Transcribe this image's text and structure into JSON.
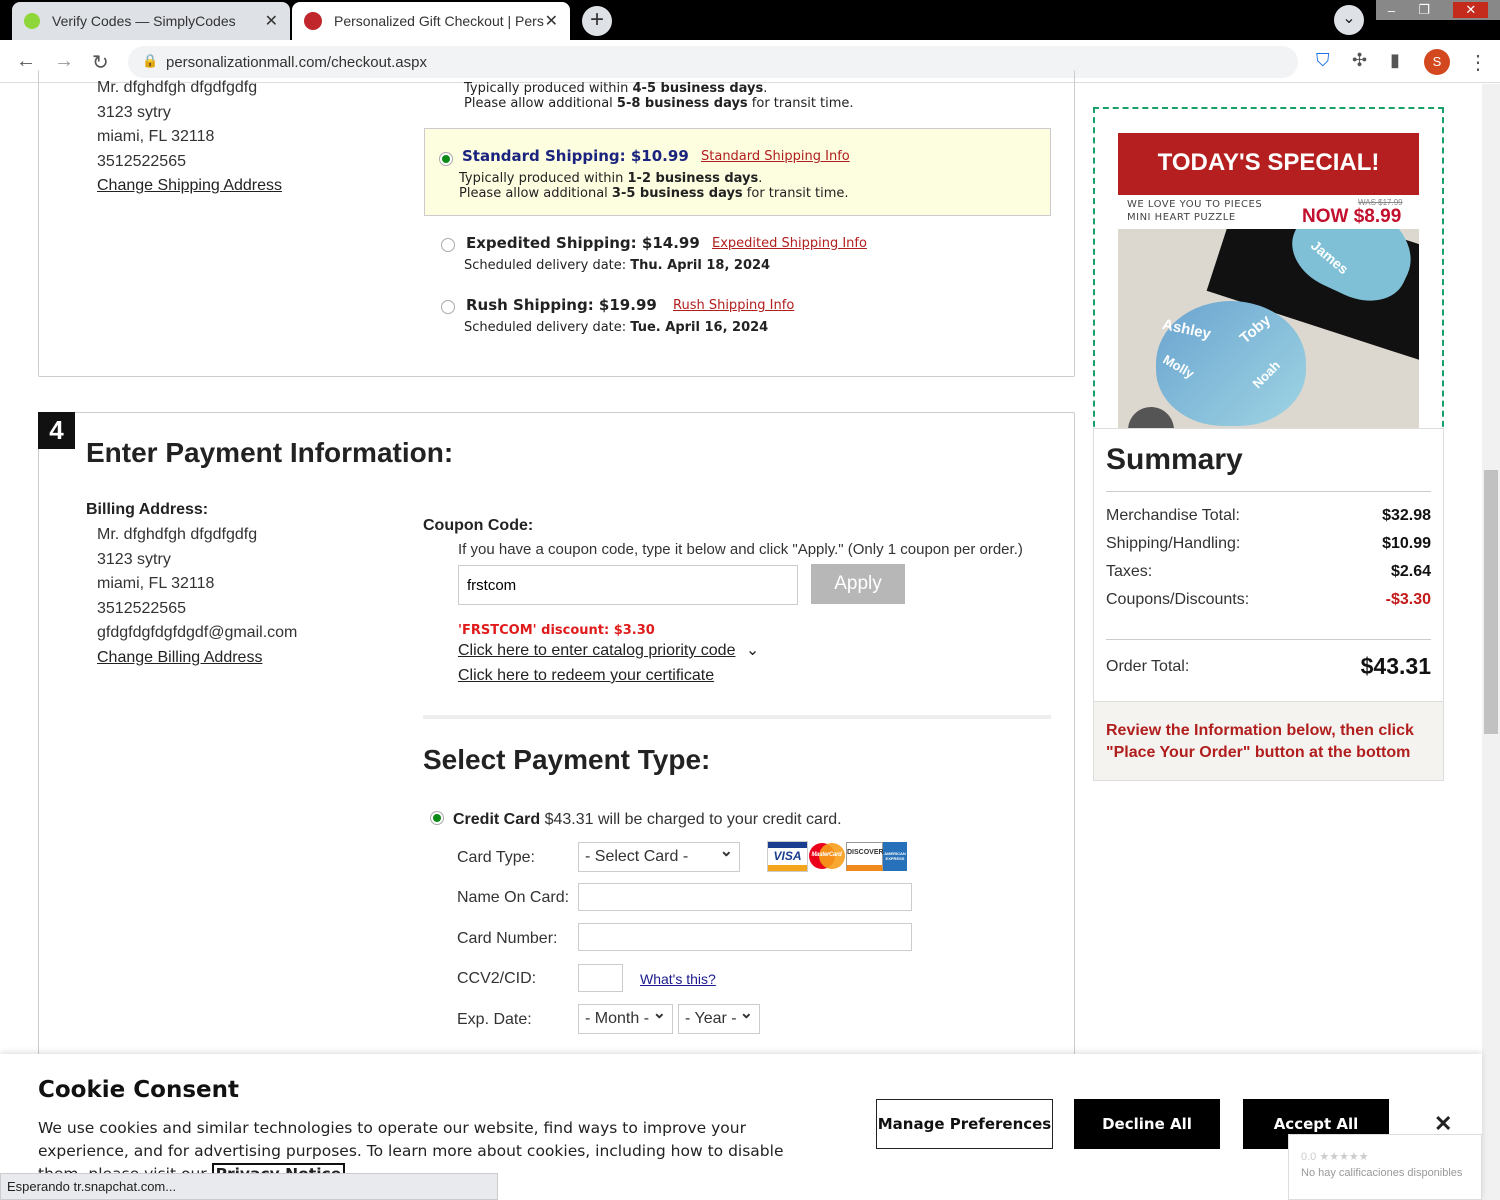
{
  "browser": {
    "tabs": [
      {
        "title": "Verify Codes — SimplyCodes",
        "icon": "simplycodes-icon"
      },
      {
        "title": "Personalized Gift Checkout | Pers",
        "icon": "pm-icon"
      }
    ],
    "url": "personalizationmall.com/checkout.aspx",
    "profile_initial": "S",
    "status": "Esperando tr.snapchat.com..."
  },
  "shipping_address": {
    "lines": [
      "Mr. dfghdfgh dfgdfgdfg",
      "3123 sytry",
      "miami, FL 32118",
      "3512522565"
    ],
    "change_label": "Change Shipping Address"
  },
  "shipping_options": {
    "top_partial": {
      "line1_pre": "Typically produced within ",
      "line1_bold": "4-5 business days",
      "line1_post": ".",
      "line2_pre": "Please allow additional ",
      "line2_bold": "5-8 business days",
      "line2_post": " for transit time."
    },
    "standard": {
      "title": "Standard Shipping: $10.99",
      "info": "Standard Shipping Info",
      "line1_pre": "Typically produced within ",
      "line1_bold": "1-2 business days",
      "line1_post": ".",
      "line2_pre": "Please allow additional ",
      "line2_bold": "3-5 business days",
      "line2_post": " for transit time.",
      "selected": true
    },
    "expedited": {
      "title": "Expedited Shipping: $14.99",
      "info": "Expedited Shipping Info",
      "date_label": "Scheduled delivery date: ",
      "date": "Thu. April 18, 2024"
    },
    "rush": {
      "title": "Rush Shipping: $19.99",
      "info": "Rush Shipping Info",
      "date_label": "Scheduled delivery date: ",
      "date": "Tue. April 16, 2024"
    }
  },
  "payment": {
    "step": "4",
    "title": "Enter Payment Information:",
    "billing_label": "Billing Address:",
    "billing_lines": [
      "Mr. dfghdfgh dfgdfgdfg",
      "3123 sytry",
      "miami, FL 32118",
      "3512522565",
      "gfdgfdgfdgfdgdf@gmail.com"
    ],
    "change_billing": "Change Billing Address",
    "coupon_label": "Coupon Code:",
    "coupon_help": "If you have a coupon code, type it below and click \"Apply.\" (Only 1 coupon per order.)",
    "coupon_value": "frstcom",
    "apply": "Apply",
    "discount_msg": "'FRSTCOM' discount: $3.30",
    "catalog_link": "Click here to enter catalog priority code",
    "certificate_link": "Click here to redeem your certificate",
    "type_title": "Select Payment Type:",
    "cc_label": "Credit Card",
    "cc_text": " $43.31 will be charged to your credit card.",
    "card_type_label": "Card Type:",
    "card_type_value": "- Select Card -",
    "cards": [
      "VISA",
      "MasterCard",
      "DISCOVER",
      "AMERICAN EXPRESS"
    ],
    "name_label": "Name On Card:",
    "number_label": "Card Number:",
    "ccv_label": "CCV2/CID:",
    "whats_this": "What's this?",
    "exp_label": "Exp. Date:",
    "month": "- Month -",
    "year": "- Year -"
  },
  "special": {
    "banner": "TODAY'S SPECIAL!",
    "product_line1": "WE LOVE YOU TO PIECES",
    "product_line2": "MINI HEART PUZZLE",
    "was": "WAS $17.99",
    "now": "NOW $8.99",
    "puzzle_names": [
      "Ashley",
      "Toby",
      "Molly",
      "Noah",
      "James"
    ]
  },
  "summary": {
    "title": "Summary",
    "rows": [
      {
        "label": "Merchandise Total:",
        "value": "$32.98"
      },
      {
        "label": "Shipping/Handling:",
        "value": "$10.99"
      },
      {
        "label": "Taxes:",
        "value": "$2.64"
      },
      {
        "label": "Coupons/Discounts:",
        "value": "-$3.30"
      }
    ],
    "total_label": "Order Total:",
    "total_value": "$43.31",
    "note": "Review the Information below, then click \"Place Your Order\" button at the bottom"
  },
  "cookie": {
    "title": "Cookie Consent",
    "text": "We use cookies and similar technologies to operate our website, find ways to improve your experience, and for advertising purposes. To learn more about cookies, including how to disable them, please visit our ",
    "privacy": "Privacy Notice",
    "manage": "Manage Preferences",
    "decline": "Decline All",
    "accept": "Accept All"
  },
  "rating_widget": {
    "score": "0.0 ★★★★★",
    "text": "No hay calificaciones disponibles"
  },
  "colors": {
    "accent_red": "#b01e1e",
    "green": "#0a8a17",
    "highlight": "#fdfde0",
    "navy": "#1a237e"
  }
}
